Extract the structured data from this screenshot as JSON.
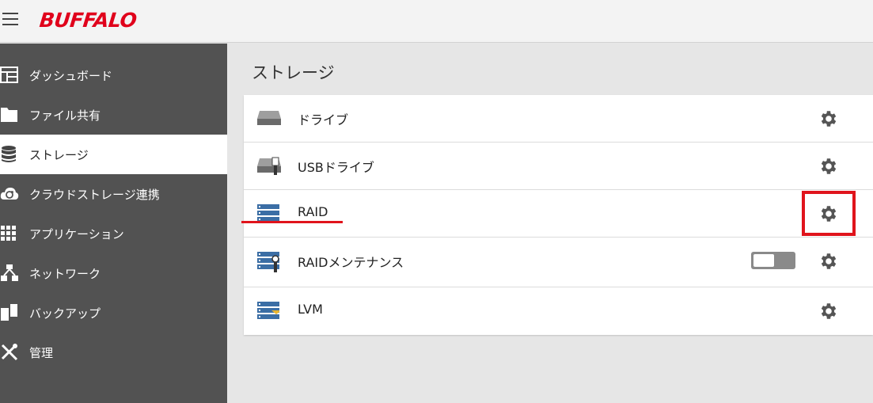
{
  "brand": {
    "logo_text": "BUFFALO",
    "accent": "#e0001b"
  },
  "sidebar": {
    "items": [
      {
        "label": "ダッシュボード",
        "icon": "dashboard-icon",
        "active": false
      },
      {
        "label": "ファイル共有",
        "icon": "folder-icon",
        "active": false
      },
      {
        "label": "ストレージ",
        "icon": "database-icon",
        "active": true
      },
      {
        "label": "クラウドストレージ連携",
        "icon": "cloud-sync-icon",
        "active": false
      },
      {
        "label": "アプリケーション",
        "icon": "apps-grid-icon",
        "active": false
      },
      {
        "label": "ネットワーク",
        "icon": "network-icon",
        "active": false
      },
      {
        "label": "バックアップ",
        "icon": "backup-icon",
        "active": false
      },
      {
        "label": "管理",
        "icon": "tools-icon",
        "active": false
      }
    ]
  },
  "main": {
    "title": "ストレージ",
    "rows": [
      {
        "label": "ドライブ",
        "icon": "drive-icon"
      },
      {
        "label": "USBドライブ",
        "icon": "usb-drive-icon"
      },
      {
        "label": "RAID",
        "icon": "raid-icon"
      },
      {
        "label": "RAIDメンテナンス",
        "icon": "raid-maintenance-icon",
        "toggle": "off"
      },
      {
        "label": "LVM",
        "icon": "lvm-icon"
      }
    ]
  },
  "colors": {
    "sidebar_bg": "#525252",
    "annotation_red": "#e0141c",
    "raid_blue": "#3b6ea5"
  }
}
